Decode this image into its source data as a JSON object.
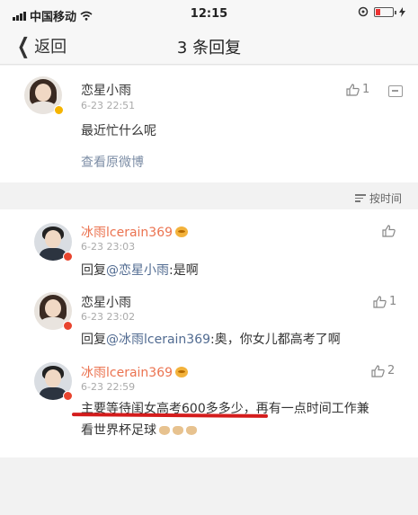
{
  "status_bar": {
    "carrier": "中国移动",
    "time": "12:15"
  },
  "nav": {
    "back_label": "返回",
    "title": "3 条回复"
  },
  "original_comment": {
    "author": "恋星小雨",
    "time": "6-23 22:51",
    "text": "最近忙什么呢",
    "likes": "1",
    "view_original": "查看原微博"
  },
  "sort_label": "按时间",
  "replies": [
    {
      "author": "冰雨lcerain369",
      "time": "6-23 23:03",
      "prefix": "回复",
      "mention": "@恋星小雨",
      "text": ":是啊",
      "likes": ""
    },
    {
      "author": "恋星小雨",
      "time": "6-23 23:02",
      "prefix": "回复",
      "mention": "@冰雨lcerain369",
      "text": ":奥，你女儿都高考了啊",
      "likes": "1"
    },
    {
      "author": "冰雨lcerain369",
      "time": "6-23 22:59",
      "line1": "主要等待闺女高考600多多少，再有一点时间工作兼",
      "line2": "看世界杯足球",
      "likes": "2"
    }
  ],
  "colors": {
    "accent_orange": "#eb7350",
    "link_blue": "#516b91",
    "underline_red": "#d41c1c"
  }
}
